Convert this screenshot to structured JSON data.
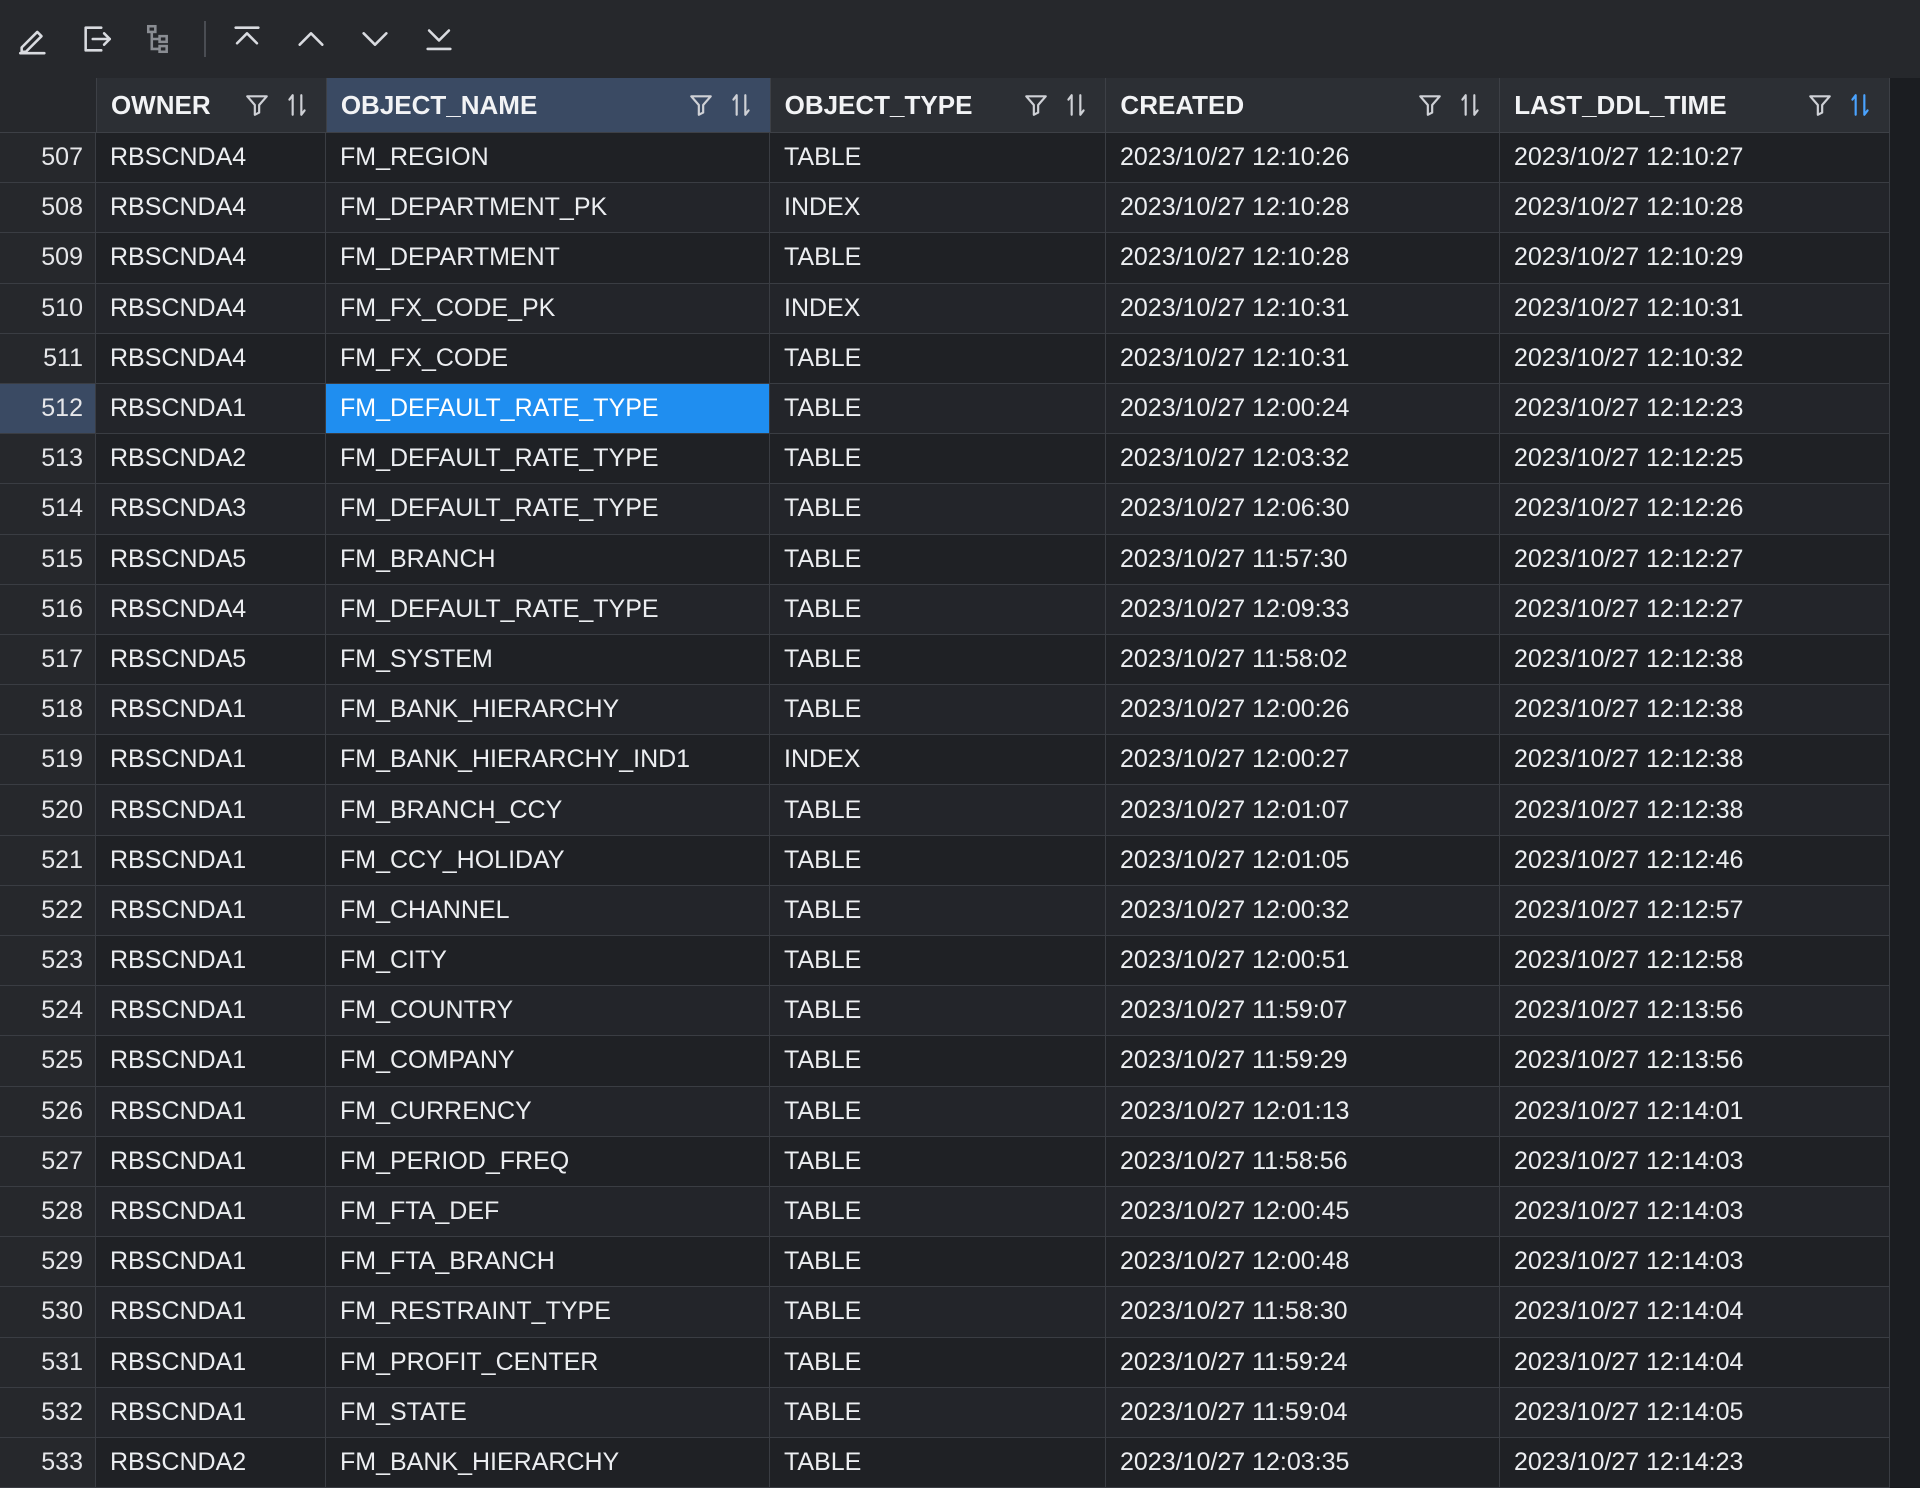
{
  "toolbar": {
    "buttons": [
      {
        "name": "edit-icon"
      },
      {
        "name": "export-icon"
      },
      {
        "name": "tree-icon"
      },
      {
        "name": "first-row-icon"
      },
      {
        "name": "previous-row-icon"
      },
      {
        "name": "next-row-icon"
      },
      {
        "name": "last-row-icon"
      }
    ]
  },
  "colors": {
    "background": "#1b1d21",
    "header": "#2c2f34",
    "selection": "#1f8ef0",
    "active_header": "#3a4a63"
  },
  "columns": [
    {
      "label": "OWNER"
    },
    {
      "label": "OBJECT_NAME"
    },
    {
      "label": "OBJECT_TYPE"
    },
    {
      "label": "CREATED"
    },
    {
      "label": "LAST_DDL_TIME"
    }
  ],
  "selected_row": "512",
  "selected_column": "OBJECT_NAME",
  "rows": [
    {
      "n": "507",
      "owner": "RBSCNDA4",
      "name": "FM_REGION",
      "type": "TABLE",
      "created": "2023/10/27 12:10:26",
      "ddl": "2023/10/27 12:10:27"
    },
    {
      "n": "508",
      "owner": "RBSCNDA4",
      "name": "FM_DEPARTMENT_PK",
      "type": "INDEX",
      "created": "2023/10/27 12:10:28",
      "ddl": "2023/10/27 12:10:28"
    },
    {
      "n": "509",
      "owner": "RBSCNDA4",
      "name": "FM_DEPARTMENT",
      "type": "TABLE",
      "created": "2023/10/27 12:10:28",
      "ddl": "2023/10/27 12:10:29"
    },
    {
      "n": "510",
      "owner": "RBSCNDA4",
      "name": "FM_FX_CODE_PK",
      "type": "INDEX",
      "created": "2023/10/27 12:10:31",
      "ddl": "2023/10/27 12:10:31"
    },
    {
      "n": "511",
      "owner": "RBSCNDA4",
      "name": "FM_FX_CODE",
      "type": "TABLE",
      "created": "2023/10/27 12:10:31",
      "ddl": "2023/10/27 12:10:32"
    },
    {
      "n": "512",
      "owner": "RBSCNDA1",
      "name": "FM_DEFAULT_RATE_TYPE",
      "type": "TABLE",
      "created": "2023/10/27 12:00:24",
      "ddl": "2023/10/27 12:12:23"
    },
    {
      "n": "513",
      "owner": "RBSCNDA2",
      "name": "FM_DEFAULT_RATE_TYPE",
      "type": "TABLE",
      "created": "2023/10/27 12:03:32",
      "ddl": "2023/10/27 12:12:25"
    },
    {
      "n": "514",
      "owner": "RBSCNDA3",
      "name": "FM_DEFAULT_RATE_TYPE",
      "type": "TABLE",
      "created": "2023/10/27 12:06:30",
      "ddl": "2023/10/27 12:12:26"
    },
    {
      "n": "515",
      "owner": "RBSCNDA5",
      "name": "FM_BRANCH",
      "type": "TABLE",
      "created": "2023/10/27 11:57:30",
      "ddl": "2023/10/27 12:12:27"
    },
    {
      "n": "516",
      "owner": "RBSCNDA4",
      "name": "FM_DEFAULT_RATE_TYPE",
      "type": "TABLE",
      "created": "2023/10/27 12:09:33",
      "ddl": "2023/10/27 12:12:27"
    },
    {
      "n": "517",
      "owner": "RBSCNDA5",
      "name": "FM_SYSTEM",
      "type": "TABLE",
      "created": "2023/10/27 11:58:02",
      "ddl": "2023/10/27 12:12:38"
    },
    {
      "n": "518",
      "owner": "RBSCNDA1",
      "name": "FM_BANK_HIERARCHY",
      "type": "TABLE",
      "created": "2023/10/27 12:00:26",
      "ddl": "2023/10/27 12:12:38"
    },
    {
      "n": "519",
      "owner": "RBSCNDA1",
      "name": "FM_BANK_HIERARCHY_IND1",
      "type": "INDEX",
      "created": "2023/10/27 12:00:27",
      "ddl": "2023/10/27 12:12:38"
    },
    {
      "n": "520",
      "owner": "RBSCNDA1",
      "name": "FM_BRANCH_CCY",
      "type": "TABLE",
      "created": "2023/10/27 12:01:07",
      "ddl": "2023/10/27 12:12:38"
    },
    {
      "n": "521",
      "owner": "RBSCNDA1",
      "name": "FM_CCY_HOLIDAY",
      "type": "TABLE",
      "created": "2023/10/27 12:01:05",
      "ddl": "2023/10/27 12:12:46"
    },
    {
      "n": "522",
      "owner": "RBSCNDA1",
      "name": "FM_CHANNEL",
      "type": "TABLE",
      "created": "2023/10/27 12:00:32",
      "ddl": "2023/10/27 12:12:57"
    },
    {
      "n": "523",
      "owner": "RBSCNDA1",
      "name": "FM_CITY",
      "type": "TABLE",
      "created": "2023/10/27 12:00:51",
      "ddl": "2023/10/27 12:12:58"
    },
    {
      "n": "524",
      "owner": "RBSCNDA1",
      "name": "FM_COUNTRY",
      "type": "TABLE",
      "created": "2023/10/27 11:59:07",
      "ddl": "2023/10/27 12:13:56"
    },
    {
      "n": "525",
      "owner": "RBSCNDA1",
      "name": "FM_COMPANY",
      "type": "TABLE",
      "created": "2023/10/27 11:59:29",
      "ddl": "2023/10/27 12:13:56"
    },
    {
      "n": "526",
      "owner": "RBSCNDA1",
      "name": "FM_CURRENCY",
      "type": "TABLE",
      "created": "2023/10/27 12:01:13",
      "ddl": "2023/10/27 12:14:01"
    },
    {
      "n": "527",
      "owner": "RBSCNDA1",
      "name": "FM_PERIOD_FREQ",
      "type": "TABLE",
      "created": "2023/10/27 11:58:56",
      "ddl": "2023/10/27 12:14:03"
    },
    {
      "n": "528",
      "owner": "RBSCNDA1",
      "name": "FM_FTA_DEF",
      "type": "TABLE",
      "created": "2023/10/27 12:00:45",
      "ddl": "2023/10/27 12:14:03"
    },
    {
      "n": "529",
      "owner": "RBSCNDA1",
      "name": "FM_FTA_BRANCH",
      "type": "TABLE",
      "created": "2023/10/27 12:00:48",
      "ddl": "2023/10/27 12:14:03"
    },
    {
      "n": "530",
      "owner": "RBSCNDA1",
      "name": "FM_RESTRAINT_TYPE",
      "type": "TABLE",
      "created": "2023/10/27 11:58:30",
      "ddl": "2023/10/27 12:14:04"
    },
    {
      "n": "531",
      "owner": "RBSCNDA1",
      "name": "FM_PROFIT_CENTER",
      "type": "TABLE",
      "created": "2023/10/27 11:59:24",
      "ddl": "2023/10/27 12:14:04"
    },
    {
      "n": "532",
      "owner": "RBSCNDA1",
      "name": "FM_STATE",
      "type": "TABLE",
      "created": "2023/10/27 11:59:04",
      "ddl": "2023/10/27 12:14:05"
    },
    {
      "n": "533",
      "owner": "RBSCNDA2",
      "name": "FM_BANK_HIERARCHY",
      "type": "TABLE",
      "created": "2023/10/27 12:03:35",
      "ddl": "2023/10/27 12:14:23"
    }
  ]
}
